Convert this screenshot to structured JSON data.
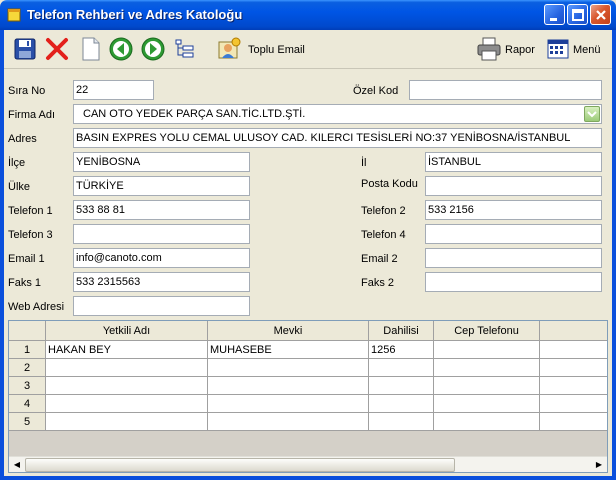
{
  "window": {
    "title": "Telefon Rehberi ve Adres Katoloğu"
  },
  "toolbar": {
    "save_icon": "save-icon",
    "delete_icon": "delete-icon",
    "new_icon": "new-document-icon",
    "prev_icon": "arrow-left-icon",
    "next_icon": "arrow-right-icon",
    "tree_icon": "tree-list-icon",
    "bulk_email_label": "Toplu Email",
    "report_label": "Rapor",
    "menu_label": "Menü"
  },
  "form": {
    "sira_no": {
      "label": "Sıra No",
      "value": "22"
    },
    "ozel_kod": {
      "label": "Özel Kod",
      "value": ""
    },
    "firma_adi": {
      "label": "Firma Adı",
      "value": "CAN OTO YEDEK PARÇA SAN.TİC.LTD.ŞTİ."
    },
    "adres": {
      "label": "Adres",
      "value": "BASIN EXPRES YOLU CEMAL ULUSOY CAD. KILERCI  TESİSLERİ NO:37 YENİBOSNA/İSTANBUL"
    },
    "ilce": {
      "label": "İlçe",
      "value": "YENİBOSNA"
    },
    "il": {
      "label": "İl",
      "value": "İSTANBUL"
    },
    "ulke": {
      "label": "Ülke",
      "value": "TÜRKİYE"
    },
    "posta_kodu": {
      "label": "Posta Kodu",
      "value": ""
    },
    "telefon1": {
      "label": "Telefon 1",
      "value": "533 88 81"
    },
    "telefon2": {
      "label": "Telefon 2",
      "value": "533 2156"
    },
    "telefon3": {
      "label": "Telefon 3",
      "value": ""
    },
    "telefon4": {
      "label": "Telefon 4",
      "value": ""
    },
    "email1": {
      "label": "Email 1",
      "value": "info@canoto.com"
    },
    "email2": {
      "label": "Email 2",
      "value": ""
    },
    "faks1": {
      "label": "Faks 1",
      "value": "533 2315563"
    },
    "faks2": {
      "label": "Faks 2",
      "value": ""
    },
    "web": {
      "label": "Web Adresi",
      "value": ""
    }
  },
  "grid": {
    "columns": [
      "Yetkili Adı",
      "Mevki",
      "Dahilisi",
      "Cep Telefonu"
    ],
    "rows": [
      {
        "num": "1",
        "cells": [
          "HAKAN BEY",
          "MUHASEBE",
          "1256",
          ""
        ]
      },
      {
        "num": "2",
        "cells": [
          "",
          "",
          "",
          ""
        ]
      },
      {
        "num": "3",
        "cells": [
          "",
          "",
          "",
          ""
        ]
      },
      {
        "num": "4",
        "cells": [
          "",
          "",
          "",
          ""
        ]
      },
      {
        "num": "5",
        "cells": [
          "",
          "",
          "",
          ""
        ]
      }
    ]
  }
}
